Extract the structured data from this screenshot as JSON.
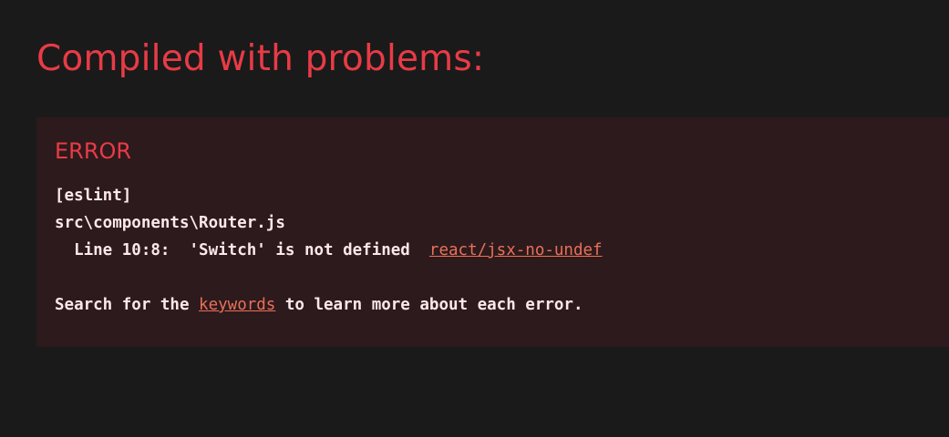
{
  "overlay": {
    "title": "Compiled with problems:",
    "colors": {
      "background": "#1a1a1a",
      "panel": "#2d1a1c",
      "accent": "#e83b46",
      "text": "#fce8e8",
      "link": "#e8705a"
    }
  },
  "error": {
    "heading": "ERROR",
    "source_tag": "[eslint]",
    "file_path": "src\\components\\Router.js",
    "line_label": "Line 10:8:",
    "message": "'Switch' is not defined",
    "rule_link": "react/jsx-no-undef",
    "search_prefix": "Search for the ",
    "keywords_link": "keywords",
    "search_suffix": " to learn more about each error."
  }
}
